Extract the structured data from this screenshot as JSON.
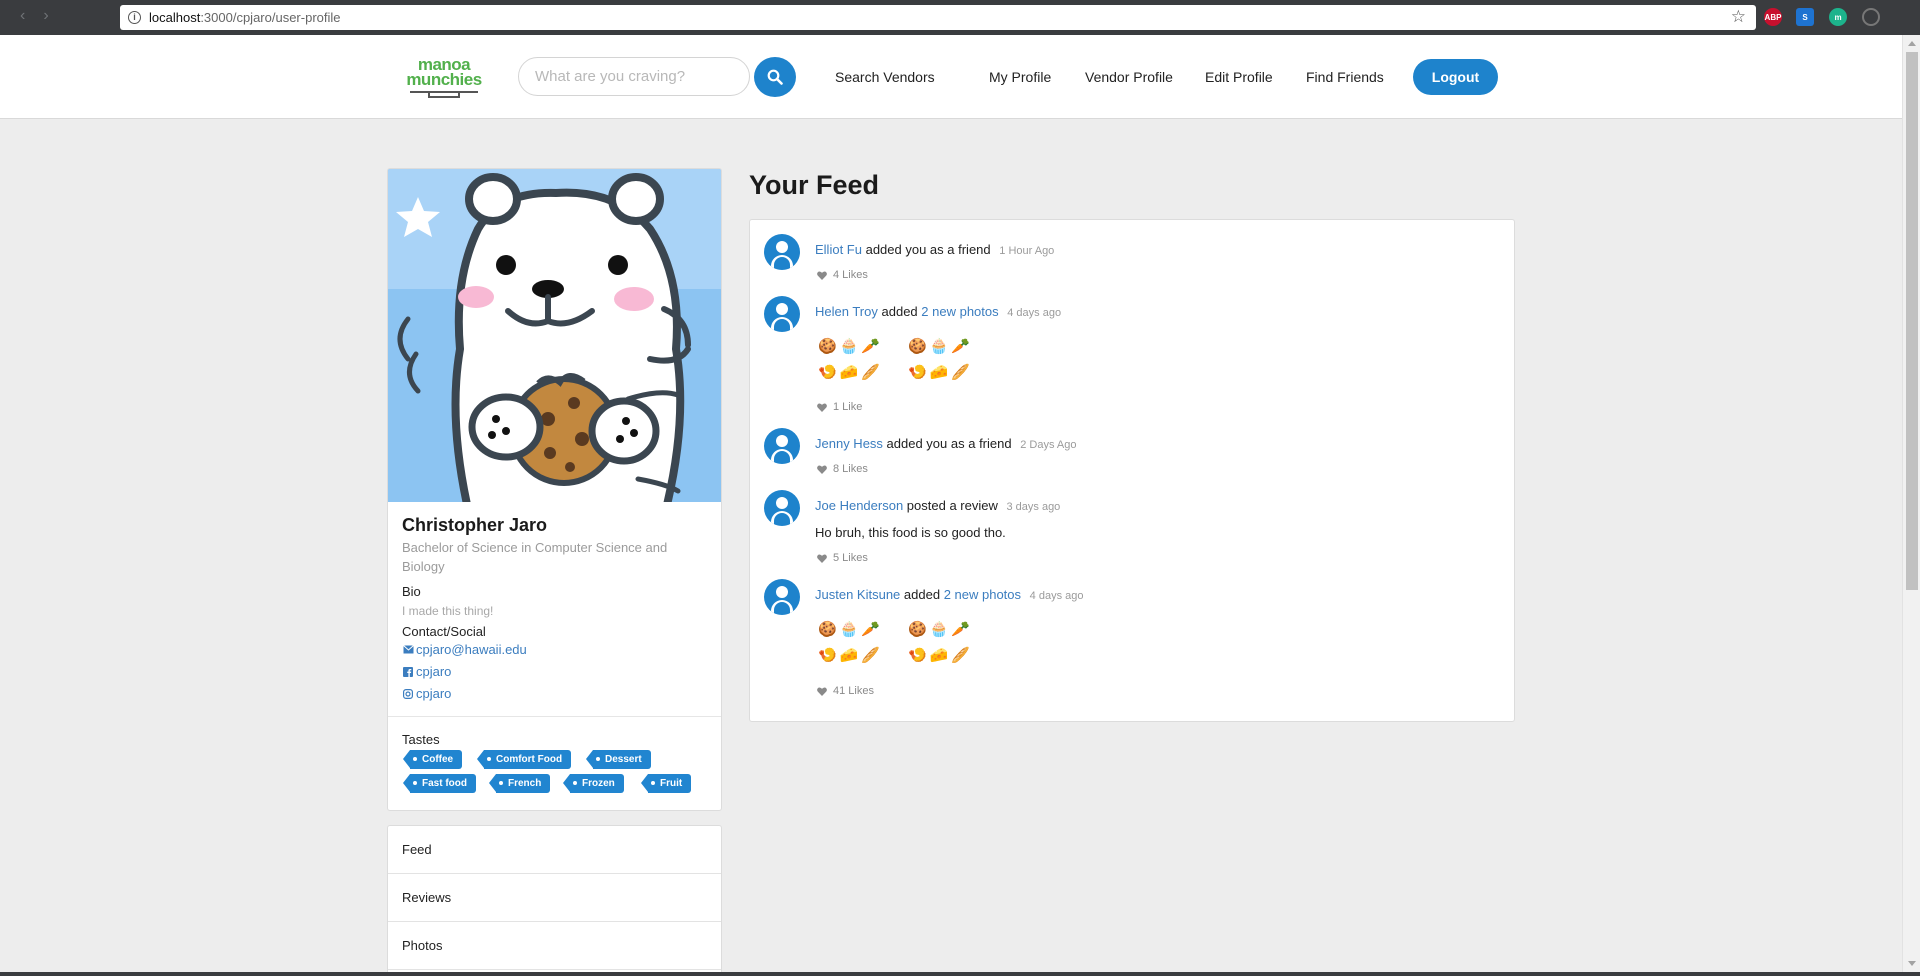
{
  "browser": {
    "url_host": "localhost",
    "url_path": ":3000/cpjaro/user-profile"
  },
  "header": {
    "logo_line1": "manoa",
    "logo_line2": "munchies",
    "search_placeholder": "What are you craving?",
    "nav": {
      "search_vendors": "Search Vendors",
      "my_profile": "My Profile",
      "vendor_profile": "Vendor Profile",
      "edit_profile": "Edit Profile",
      "find_friends": "Find Friends"
    },
    "logout_label": "Logout"
  },
  "profile": {
    "name": "Christopher Jaro",
    "degree": "Bachelor of Science in Computer Science and Biology",
    "bio_label": "Bio",
    "bio": "I made this thing!",
    "contact_label": "Contact/Social",
    "email": "cpjaro@hawaii.edu",
    "facebook": "cpjaro",
    "instagram": "cpjaro",
    "tastes_label": "Tastes",
    "tastes": [
      "Coffee",
      "Comfort Food",
      "Dessert",
      "Fast food",
      "French",
      "Frozen",
      "Fruit"
    ]
  },
  "menu": {
    "items": [
      "Feed",
      "Reviews",
      "Photos"
    ]
  },
  "feed": {
    "title": "Your Feed",
    "items": [
      {
        "user": "Elliot Fu",
        "action": "added you as a friend",
        "time": "1 Hour Ago",
        "likes": "4 Likes"
      },
      {
        "user": "Helen Troy",
        "action": "added",
        "link": "2 new photos",
        "time": "4 days ago",
        "likes": "1 Like"
      },
      {
        "user": "Jenny Hess",
        "action": "added you as a friend",
        "time": "2 Days Ago",
        "likes": "8 Likes"
      },
      {
        "user": "Joe Henderson",
        "action": "posted a review",
        "time": "3 days ago",
        "text": "Ho bruh, this food is so good tho.",
        "likes": "5 Likes"
      },
      {
        "user": "Justen Kitsune",
        "action": "added",
        "link": "2 new photos",
        "time": "4 days ago",
        "likes": "41 Likes"
      }
    ]
  },
  "photo_emoji": {
    "row1": "🍪🧁🥕",
    "row2": "🍤🧀🥖"
  },
  "colors": {
    "accent": "#1e83cc",
    "link": "#3b7dbf",
    "logo_green": "#52b04c",
    "avatar_bg": "#8cc4f2"
  }
}
